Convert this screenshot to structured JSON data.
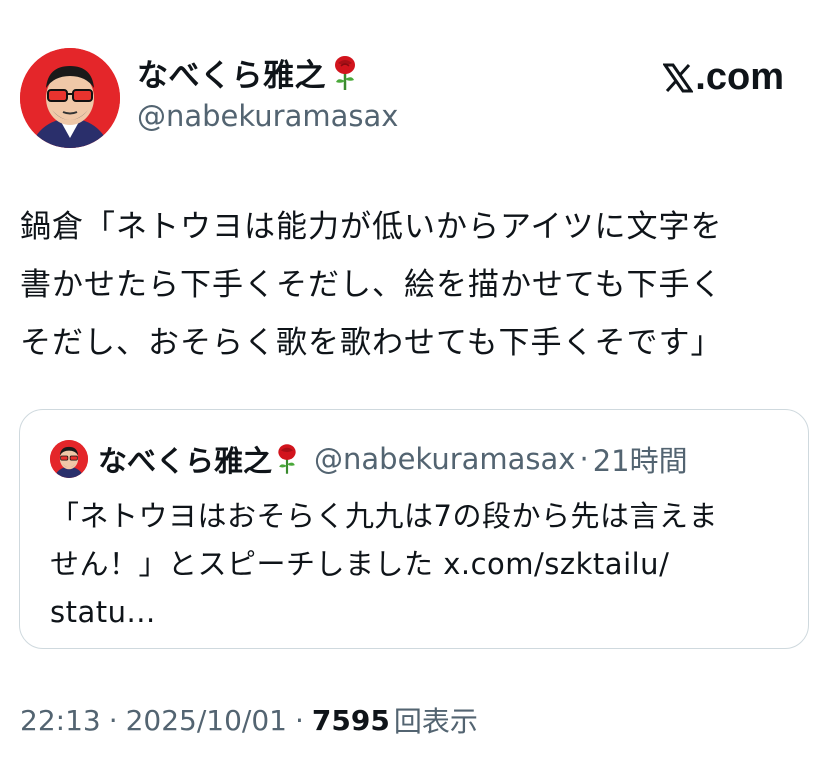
{
  "brand": {
    "label": ".com"
  },
  "author": {
    "name": "なべくら雅之",
    "handle": "@nabekuramasax"
  },
  "tweet": {
    "text": "鍋倉「ネトウヨは能力が低いからアイツに文字を\n書かせたら下手くそだし、絵を描かせても下手く\nそだし、おそらく歌を歌わせても下手くそです」"
  },
  "quote": {
    "name": "なべくら雅之",
    "handle": "@nabekuramasax",
    "separator": "·",
    "time": "21時間",
    "text": "「ネトウヨはおそらく九九は7の段から先は言えま\nせん！」とスピーチしました x.com/szktailu/\nstatu..."
  },
  "meta": {
    "time": "22:13",
    "separator": "·",
    "date": "2025/10/01",
    "views": "7595",
    "views_suffix": "回表示"
  },
  "icons": {
    "x_logo": "x-logo-icon",
    "rose": "rose-icon",
    "avatar": "avatar-illustration"
  },
  "colors": {
    "text": "#0f1419",
    "secondary": "#536471",
    "border": "#cfd9de",
    "avatar_bg": "#e4262a"
  }
}
